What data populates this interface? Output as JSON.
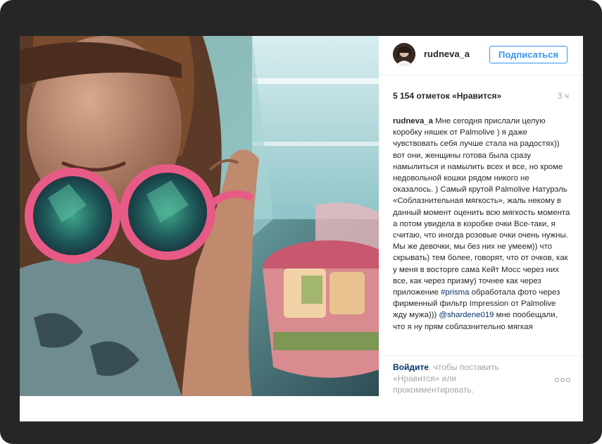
{
  "post": {
    "username": "rudneva_a",
    "follow_label": "Подписаться",
    "likes": "5 154 отметок «Нравится»",
    "time": "3 ч",
    "caption": {
      "user": "rudneva_a",
      "part1": " Мне сегодня прислали целую коробку няшек от Palmolive ) я даже чувствовать себя лучше стала на радостях)) вот они, женщины  готова была сразу намылиться и намылить всех и все, но кроме недовольной кошки рядом никого не оказалось. ) Самый крутой Palmolive Натурэль «Соблазнительная мягкость», жаль некому в данный момент оценить всю мягкость момента а потом увидела в коробке очки Все-таки, я считаю, что иногда розовые очки очень нужны. Мы же девочки, мы без них не умеем)) что скрывать) тем более, говорят, что от очков, как у меня в восторге сама Кейт Мосс через них все, как через призму) точнее как через приложение ",
      "hashtag": "#prisma",
      "part2": " обработала фото через фирменный фильтр Impression от Palmolive  жду мужа))) ",
      "mention": "@shardene019",
      "part3": " мне пообещали, что я ну прям соблазнительно мягкая "
    },
    "login_link": "Войдите",
    "login_rest": ", чтобы поставить «Нравится» или прокомментировать.",
    "more_icon": "ellipsis-icon"
  },
  "colors": {
    "frame": "#262626",
    "accent": "#3897f0",
    "link": "#003569",
    "muted": "#a5a5a5"
  }
}
